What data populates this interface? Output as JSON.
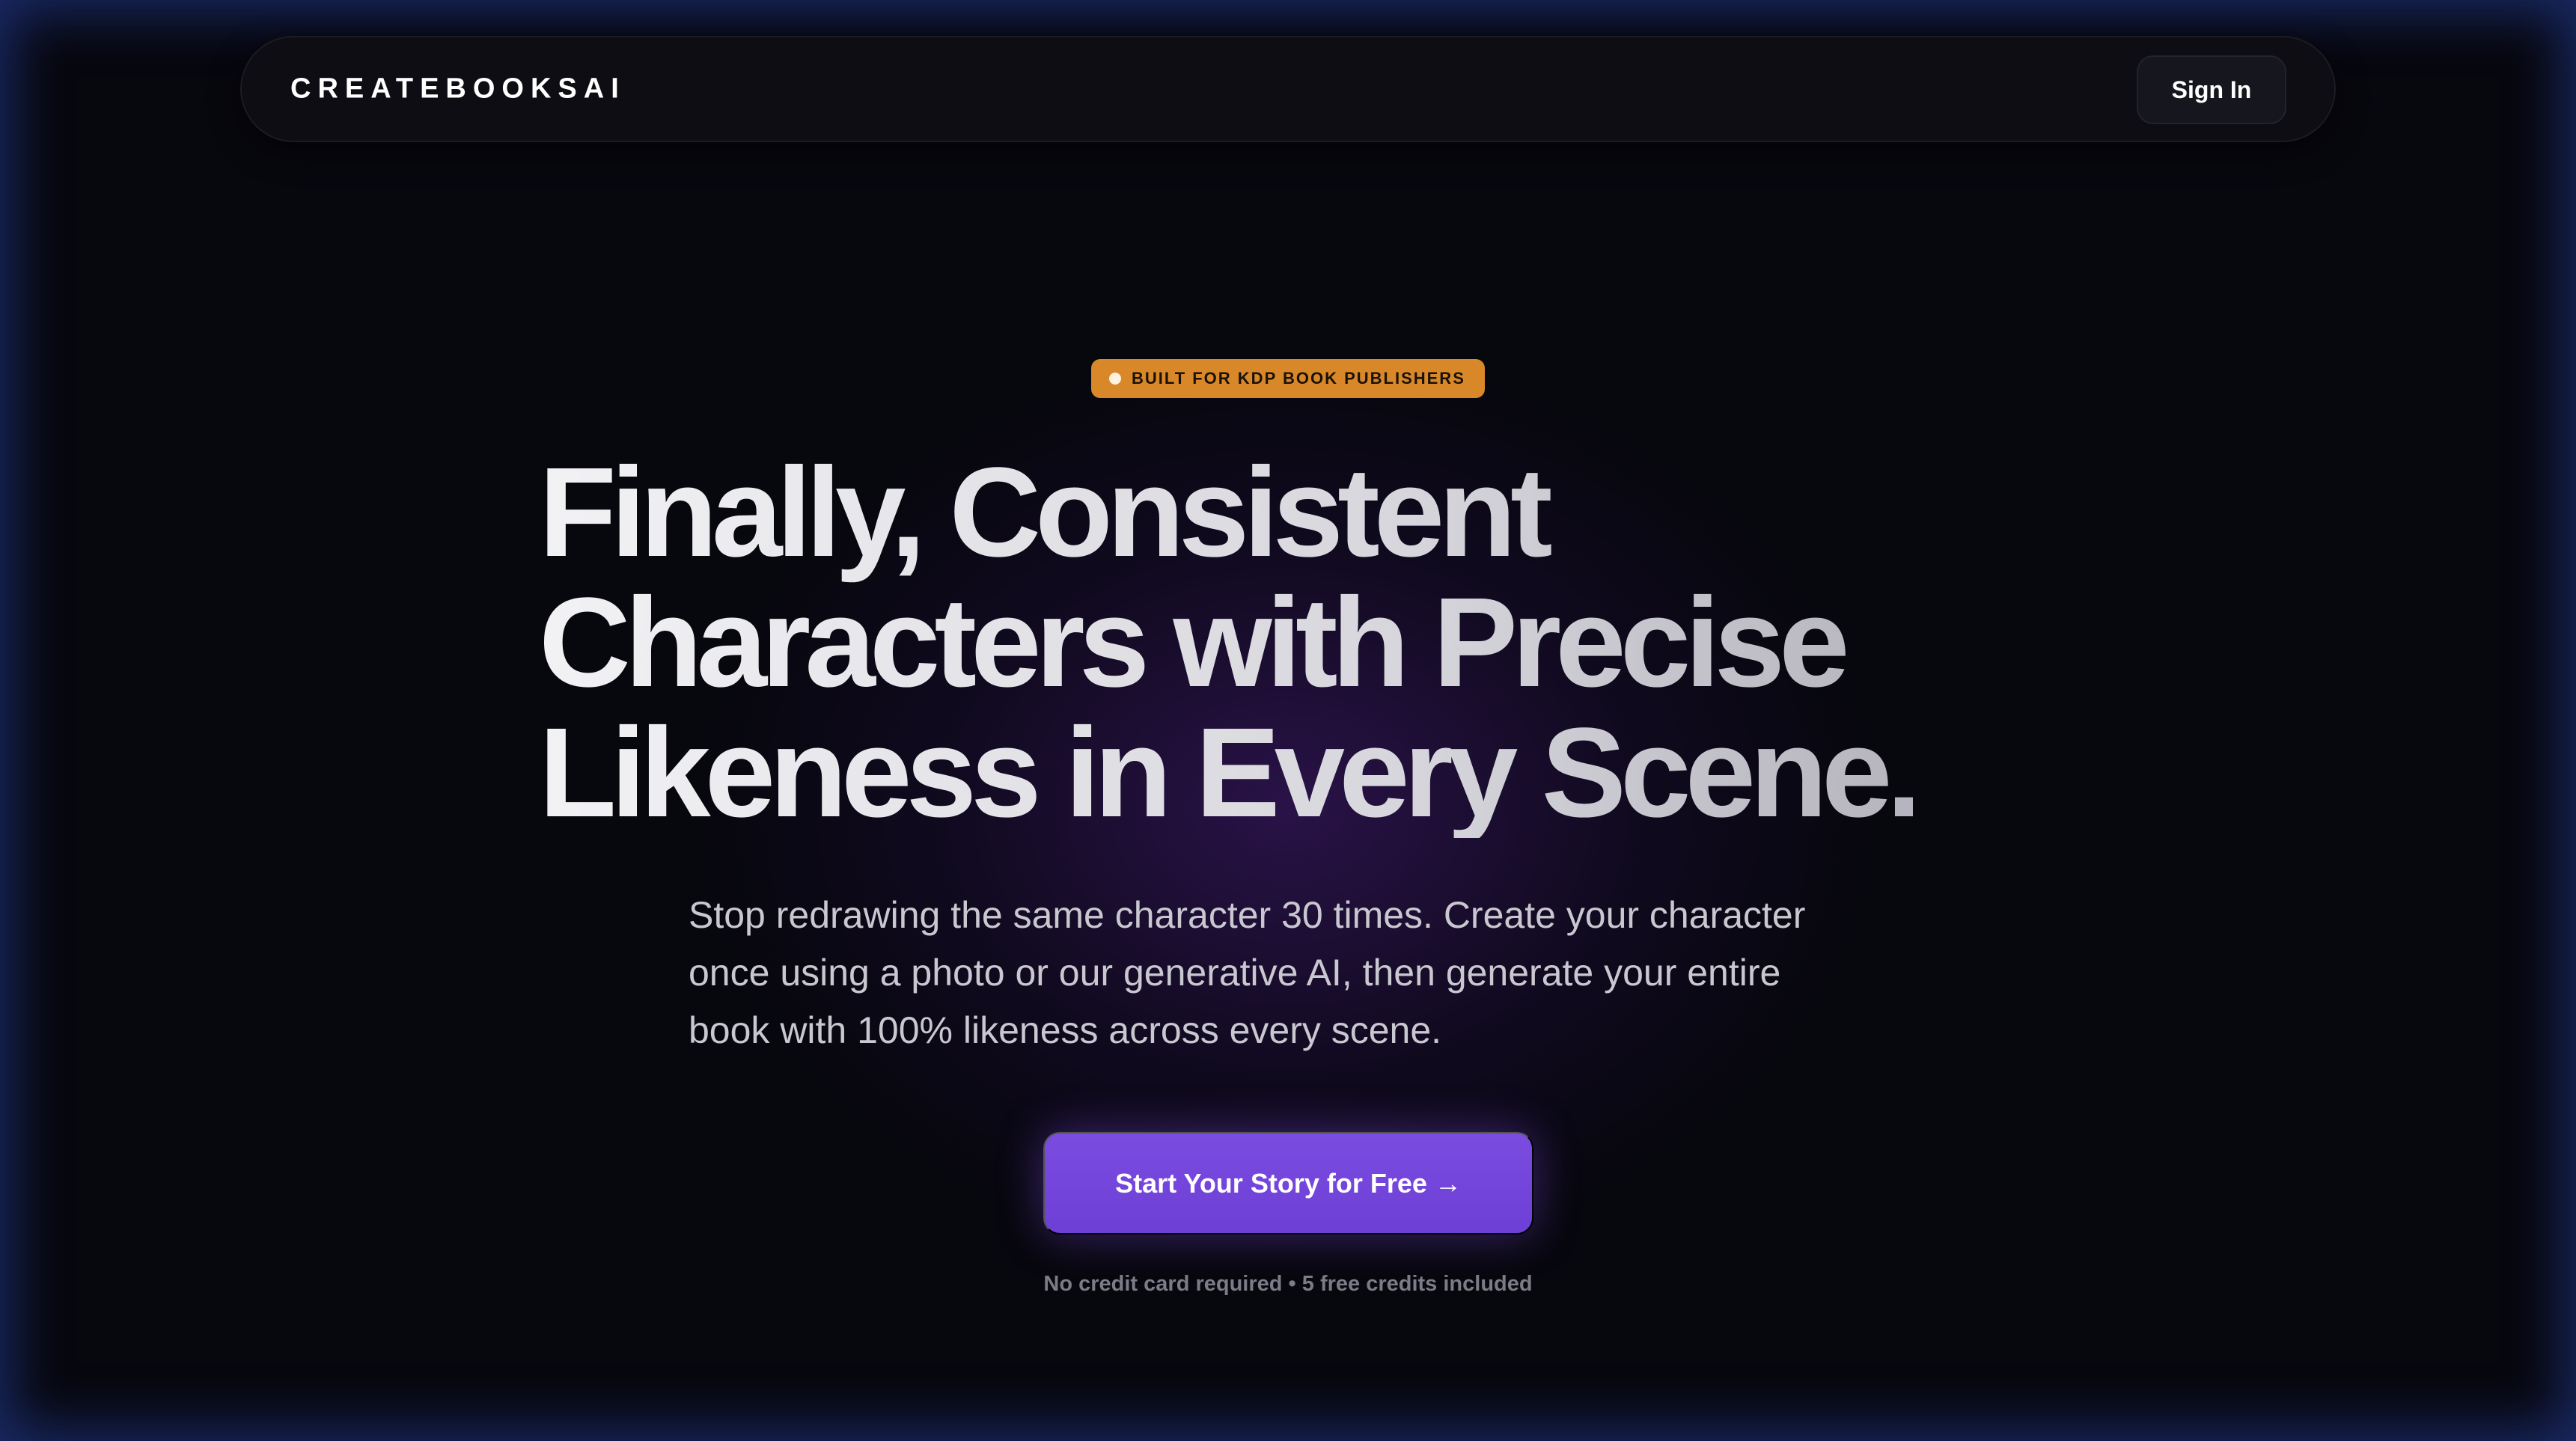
{
  "nav": {
    "brand": "CREATEBOOKSAI",
    "sign_in_label": "Sign In"
  },
  "hero": {
    "badge_text": "BUILT FOR KDP BOOK PUBLISHERS",
    "headline_lines": [
      "Finally, Consistent",
      "Characters with Precise",
      "Likeness in Every Scene."
    ],
    "subtitle_lines": [
      "Stop redrawing the same character 30 times. Create your character",
      "once using a photo or our generative AI, then generate your entire",
      "book with 100% likeness across every scene."
    ],
    "cta_label": "Start Your Story for Free →",
    "note": "No credit card required • 5 free credits included"
  },
  "colors": {
    "background": "#07070e",
    "badge": "#d98829",
    "cta": "#7c4ce0",
    "frame_glow": "#2846aa"
  }
}
